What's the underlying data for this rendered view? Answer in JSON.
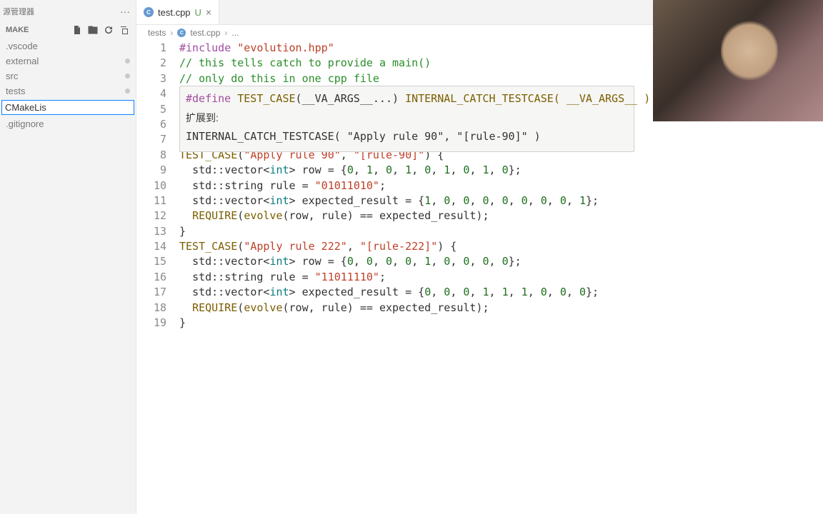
{
  "sidebar": {
    "title": "源管理器",
    "section": "MAKE",
    "items": [
      {
        "label": ".vscode",
        "modified": false
      },
      {
        "label": "external",
        "modified": true
      },
      {
        "label": "src",
        "modified": true
      },
      {
        "label": "tests",
        "modified": true
      }
    ],
    "input_value": "CMakeLis",
    "trailing": [
      {
        "label": ".gitignore",
        "modified": false
      }
    ]
  },
  "tab": {
    "filename": "test.cpp",
    "status": "U"
  },
  "breadcrumbs": {
    "part1": "tests",
    "part2": "test.cpp",
    "part3": "..."
  },
  "hover": {
    "define_kw": "#define",
    "macro_name": "TEST_CASE",
    "macro_params": "(__VA_ARGS__...)",
    "macro_body": "INTERNAL_CATCH_TESTCASE( __VA_ARGS__ )",
    "expand_label": "扩展到:",
    "expansion": "INTERNAL_CATCH_TESTCASE( \"Apply rule 90\", \"[rule-90]\" )"
  },
  "code": {
    "lines": [
      {
        "n": 1,
        "tokens": [
          [
            "pre",
            "#include "
          ],
          [
            "str",
            "\"evolution.hpp\""
          ]
        ]
      },
      {
        "n": 2,
        "tokens": [
          [
            "cmt",
            "// this tells catch to provide a main()"
          ]
        ]
      },
      {
        "n": 3,
        "tokens": [
          [
            "cmt",
            "// only do this in one cpp file"
          ]
        ]
      },
      {
        "n": 4,
        "tokens": []
      },
      {
        "n": 5,
        "tokens": []
      },
      {
        "n": 6,
        "tokens": []
      },
      {
        "n": 7,
        "tokens": []
      },
      {
        "n": 8,
        "tokens": [
          [
            "fn",
            "TEST_CASE"
          ],
          [
            "punc",
            "("
          ],
          [
            "str",
            "\"Apply rule 90\""
          ],
          [
            "punc",
            ", "
          ],
          [
            "str",
            "\"[rule-90]\""
          ],
          [
            "punc",
            ") {"
          ]
        ]
      },
      {
        "n": 9,
        "tokens": [
          [
            "punc",
            "  "
          ],
          [
            "ns",
            "std"
          ],
          [
            "punc",
            "::"
          ],
          [
            "ns",
            "vector"
          ],
          [
            "punc",
            "<"
          ],
          [
            "type",
            "int"
          ],
          [
            "punc",
            "> row = {"
          ],
          [
            "num",
            "0"
          ],
          [
            "punc",
            ", "
          ],
          [
            "num",
            "1"
          ],
          [
            "punc",
            ", "
          ],
          [
            "num",
            "0"
          ],
          [
            "punc",
            ", "
          ],
          [
            "num",
            "1"
          ],
          [
            "punc",
            ", "
          ],
          [
            "num",
            "0"
          ],
          [
            "punc",
            ", "
          ],
          [
            "num",
            "1"
          ],
          [
            "punc",
            ", "
          ],
          [
            "num",
            "0"
          ],
          [
            "punc",
            ", "
          ],
          [
            "num",
            "1"
          ],
          [
            "punc",
            ", "
          ],
          [
            "num",
            "0"
          ],
          [
            "punc",
            "};"
          ]
        ]
      },
      {
        "n": 10,
        "tokens": [
          [
            "punc",
            "  "
          ],
          [
            "ns",
            "std"
          ],
          [
            "punc",
            "::"
          ],
          [
            "ns",
            "string"
          ],
          [
            "punc",
            " rule = "
          ],
          [
            "str",
            "\"01011010\""
          ],
          [
            "punc",
            ";"
          ]
        ]
      },
      {
        "n": 11,
        "tokens": [
          [
            "punc",
            "  "
          ],
          [
            "ns",
            "std"
          ],
          [
            "punc",
            "::"
          ],
          [
            "ns",
            "vector"
          ],
          [
            "punc",
            "<"
          ],
          [
            "type",
            "int"
          ],
          [
            "punc",
            "> expected_result = {"
          ],
          [
            "num",
            "1"
          ],
          [
            "punc",
            ", "
          ],
          [
            "num",
            "0"
          ],
          [
            "punc",
            ", "
          ],
          [
            "num",
            "0"
          ],
          [
            "punc",
            ", "
          ],
          [
            "num",
            "0"
          ],
          [
            "punc",
            ", "
          ],
          [
            "num",
            "0"
          ],
          [
            "punc",
            ", "
          ],
          [
            "num",
            "0"
          ],
          [
            "punc",
            ", "
          ],
          [
            "num",
            "0"
          ],
          [
            "punc",
            ", "
          ],
          [
            "num",
            "0"
          ],
          [
            "punc",
            ", "
          ],
          [
            "num",
            "1"
          ],
          [
            "punc",
            "};"
          ]
        ]
      },
      {
        "n": 12,
        "tokens": [
          [
            "punc",
            "  "
          ],
          [
            "fn",
            "REQUIRE"
          ],
          [
            "punc",
            "("
          ],
          [
            "fn",
            "evolve"
          ],
          [
            "punc",
            "(row, rule) == expected_result);"
          ]
        ]
      },
      {
        "n": 13,
        "tokens": [
          [
            "punc",
            "}"
          ]
        ]
      },
      {
        "n": 14,
        "tokens": [
          [
            "fn",
            "TEST_CASE"
          ],
          [
            "punc",
            "("
          ],
          [
            "str",
            "\"Apply rule 222\""
          ],
          [
            "punc",
            ", "
          ],
          [
            "str",
            "\"[rule-222]\""
          ],
          [
            "punc",
            ") {"
          ]
        ]
      },
      {
        "n": 15,
        "tokens": [
          [
            "punc",
            "  "
          ],
          [
            "ns",
            "std"
          ],
          [
            "punc",
            "::"
          ],
          [
            "ns",
            "vector"
          ],
          [
            "punc",
            "<"
          ],
          [
            "type",
            "int"
          ],
          [
            "punc",
            "> row = {"
          ],
          [
            "num",
            "0"
          ],
          [
            "punc",
            ", "
          ],
          [
            "num",
            "0"
          ],
          [
            "punc",
            ", "
          ],
          [
            "num",
            "0"
          ],
          [
            "punc",
            ", "
          ],
          [
            "num",
            "0"
          ],
          [
            "punc",
            ", "
          ],
          [
            "num",
            "1"
          ],
          [
            "punc",
            ", "
          ],
          [
            "num",
            "0"
          ],
          [
            "punc",
            ", "
          ],
          [
            "num",
            "0"
          ],
          [
            "punc",
            ", "
          ],
          [
            "num",
            "0"
          ],
          [
            "punc",
            ", "
          ],
          [
            "num",
            "0"
          ],
          [
            "punc",
            "};"
          ]
        ]
      },
      {
        "n": 16,
        "tokens": [
          [
            "punc",
            "  "
          ],
          [
            "ns",
            "std"
          ],
          [
            "punc",
            "::"
          ],
          [
            "ns",
            "string"
          ],
          [
            "punc",
            " rule = "
          ],
          [
            "str",
            "\"11011110\""
          ],
          [
            "punc",
            ";"
          ]
        ]
      },
      {
        "n": 17,
        "tokens": [
          [
            "punc",
            "  "
          ],
          [
            "ns",
            "std"
          ],
          [
            "punc",
            "::"
          ],
          [
            "ns",
            "vector"
          ],
          [
            "punc",
            "<"
          ],
          [
            "type",
            "int"
          ],
          [
            "punc",
            "> expected_result = {"
          ],
          [
            "num",
            "0"
          ],
          [
            "punc",
            ", "
          ],
          [
            "num",
            "0"
          ],
          [
            "punc",
            ", "
          ],
          [
            "num",
            "0"
          ],
          [
            "punc",
            ", "
          ],
          [
            "num",
            "1"
          ],
          [
            "punc",
            ", "
          ],
          [
            "num",
            "1"
          ],
          [
            "punc",
            ", "
          ],
          [
            "num",
            "1"
          ],
          [
            "punc",
            ", "
          ],
          [
            "num",
            "0"
          ],
          [
            "punc",
            ", "
          ],
          [
            "num",
            "0"
          ],
          [
            "punc",
            ", "
          ],
          [
            "num",
            "0"
          ],
          [
            "punc",
            "};"
          ]
        ]
      },
      {
        "n": 18,
        "tokens": [
          [
            "punc",
            "  "
          ],
          [
            "fn",
            "REQUIRE"
          ],
          [
            "punc",
            "("
          ],
          [
            "fn",
            "evolve"
          ],
          [
            "punc",
            "(row, rule) == expected_result);"
          ]
        ]
      },
      {
        "n": 19,
        "tokens": [
          [
            "punc",
            "}"
          ]
        ]
      }
    ]
  }
}
